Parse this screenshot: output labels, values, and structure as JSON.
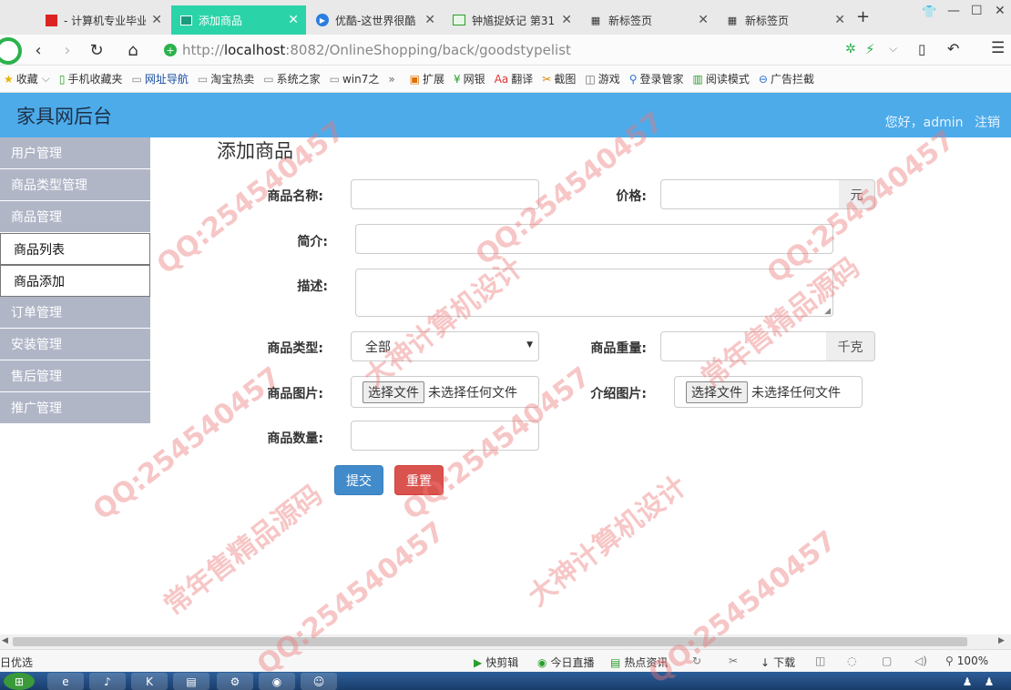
{
  "browser": {
    "tabs": [
      {
        "label": "- 计算机专业毕业",
        "icon": "red-square-icon"
      },
      {
        "label": "添加商品",
        "icon": "image-icon",
        "active": true
      },
      {
        "label": "优酷-这世界很酷",
        "icon": "youku-play-icon"
      },
      {
        "label": "钟馗捉妖记 第31",
        "icon": "video-icon"
      },
      {
        "label": "新标签页",
        "icon": "grid-icon"
      },
      {
        "label": "新标签页",
        "icon": "grid-icon"
      }
    ],
    "new_tab": "+",
    "url_scheme": "http://",
    "url_host": "localhost",
    "url_rest": ":8082/OnlineShopping/back/goodstypelist",
    "bookmarks": [
      {
        "label": "收藏",
        "icon": "star-icon"
      },
      {
        "label": "手机收藏夹",
        "icon": "phone-icon"
      },
      {
        "label": "网址导航",
        "icon": "page-icon"
      },
      {
        "label": "淘宝热卖",
        "icon": "page-icon"
      },
      {
        "label": "系统之家",
        "icon": "page-icon"
      },
      {
        "label": "win7之",
        "icon": "page-icon"
      }
    ],
    "bookmark_more": "»",
    "tools": [
      {
        "label": "扩展",
        "icon": "puzzle-icon"
      },
      {
        "label": "网银",
        "icon": "bank-icon"
      },
      {
        "label": "翻译",
        "icon": "translate-icon"
      },
      {
        "label": "截图",
        "icon": "scissors-icon"
      },
      {
        "label": "游戏",
        "icon": "gamepad-icon"
      },
      {
        "label": "登录管家",
        "icon": "key-icon"
      },
      {
        "label": "阅读模式",
        "icon": "book-icon"
      },
      {
        "label": "广告拦截",
        "icon": "block-icon"
      }
    ]
  },
  "app": {
    "brand": "家具网后台",
    "greeting": "您好，admin",
    "logout": "注销"
  },
  "sidebar": {
    "items": [
      {
        "label": "用户管理"
      },
      {
        "label": "商品类型管理"
      },
      {
        "label": "商品管理"
      },
      {
        "label": "商品列表",
        "sub": true
      },
      {
        "label": "商品添加",
        "sub": true
      },
      {
        "label": "订单管理"
      },
      {
        "label": "安装管理"
      },
      {
        "label": "售后管理"
      },
      {
        "label": "推广管理"
      }
    ]
  },
  "form": {
    "title": "添加商品",
    "name_label": "商品名称:",
    "price_label": "价格:",
    "price_unit": "元",
    "summary_label": "简介:",
    "desc_label": "描述:",
    "type_label": "商品类型:",
    "type_value": "全部",
    "weight_label": "商品重量:",
    "weight_unit": "千克",
    "image_label": "商品图片:",
    "intro_image_label": "介绍图片:",
    "file_button": "选择文件",
    "no_file": "未选择任何文件",
    "qty_label": "商品数量:",
    "submit": "提交",
    "reset": "重置"
  },
  "status": {
    "left": "日优选",
    "items": [
      "快剪辑",
      "今日直播",
      "热点资讯",
      "下载"
    ],
    "zoom": "100%"
  },
  "watermark": {
    "qq": "QQ:254540457",
    "lines": [
      "大神计算机设计",
      "常年售精品源码"
    ]
  },
  "colors": {
    "header": "#4dabea",
    "sidebar": "#b1b6c7",
    "submit": "#428bca",
    "reset": "#d9534f",
    "active_tab": "#2bd4a8"
  }
}
